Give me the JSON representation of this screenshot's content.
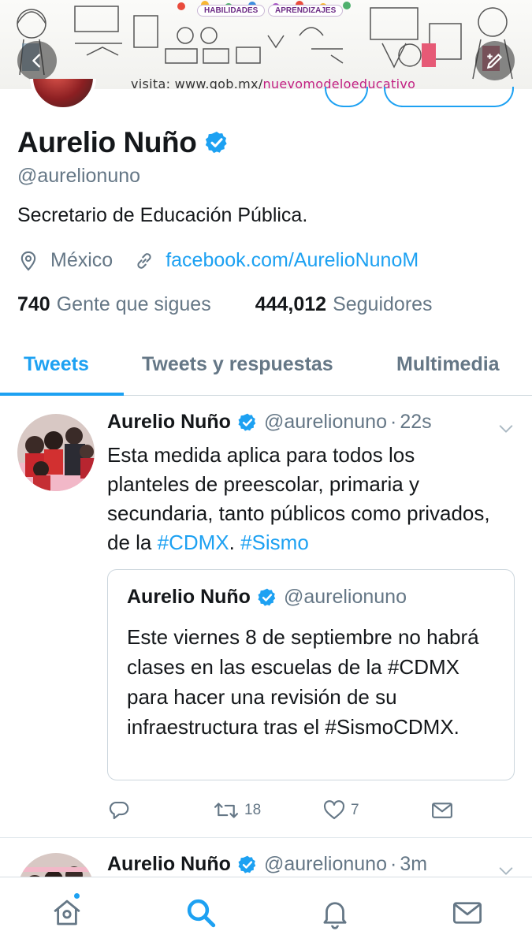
{
  "banner": {
    "label_habilidades": "HABILIDADES",
    "label_aprendizajes": "APRENDIZAJES",
    "visit_prefix": "visita: www.gob.mx/",
    "visit_link": "nuevomodeloeducativo"
  },
  "profile": {
    "name": "Aurelio Nuño",
    "handle": "@aurelionuno",
    "bio": "Secretario de Educación Pública.",
    "location": "México",
    "website": "facebook.com/AurelioNunoM",
    "following_count": "740",
    "following_label": "Gente que sigues",
    "followers_count": "444,012",
    "followers_label": "Seguidores",
    "verified": true
  },
  "tabs": [
    {
      "label": "Tweets",
      "active": true
    },
    {
      "label": "Tweets y respuestas",
      "active": false
    },
    {
      "label": "Multimedia",
      "active": false
    }
  ],
  "tweets": [
    {
      "author": "Aurelio Nuño",
      "handle": "@aurelionuno",
      "time": "22s",
      "text_parts": {
        "a": "Esta medida aplica para todos los planteles de preescolar, primaria y secundaria, tanto públicos como privados, de la ",
        "h1": "#CDMX",
        "b": ". ",
        "h2": "#Sismo"
      },
      "quoted": {
        "author": "Aurelio Nuño",
        "handle": "@aurelionuno",
        "text": "Este viernes 8 de septiembre no habrá clases en las escuelas de la #CDMX para hacer una revisión de su infraestructura tras el #SismoCDMX."
      },
      "retweets": "18",
      "likes": "7"
    },
    {
      "author": "Aurelio Nuño",
      "handle": "@aurelionuno",
      "time": "3m"
    }
  ],
  "colors": {
    "accent": "#1da1f2",
    "text_primary": "#14171a",
    "text_secondary": "#657786",
    "border": "#e1e8ed"
  },
  "icons": {
    "back": "back-arrow-icon",
    "compose": "compose-icon",
    "location": "location-pin-icon",
    "link": "link-icon",
    "verified": "verified-badge-icon",
    "caret": "chevron-down-icon",
    "reply": "reply-icon",
    "retweet": "retweet-icon",
    "like": "heart-icon",
    "dm": "envelope-icon",
    "nav": [
      "home-icon",
      "search-icon",
      "bell-icon",
      "mail-icon"
    ]
  },
  "separator": "·"
}
